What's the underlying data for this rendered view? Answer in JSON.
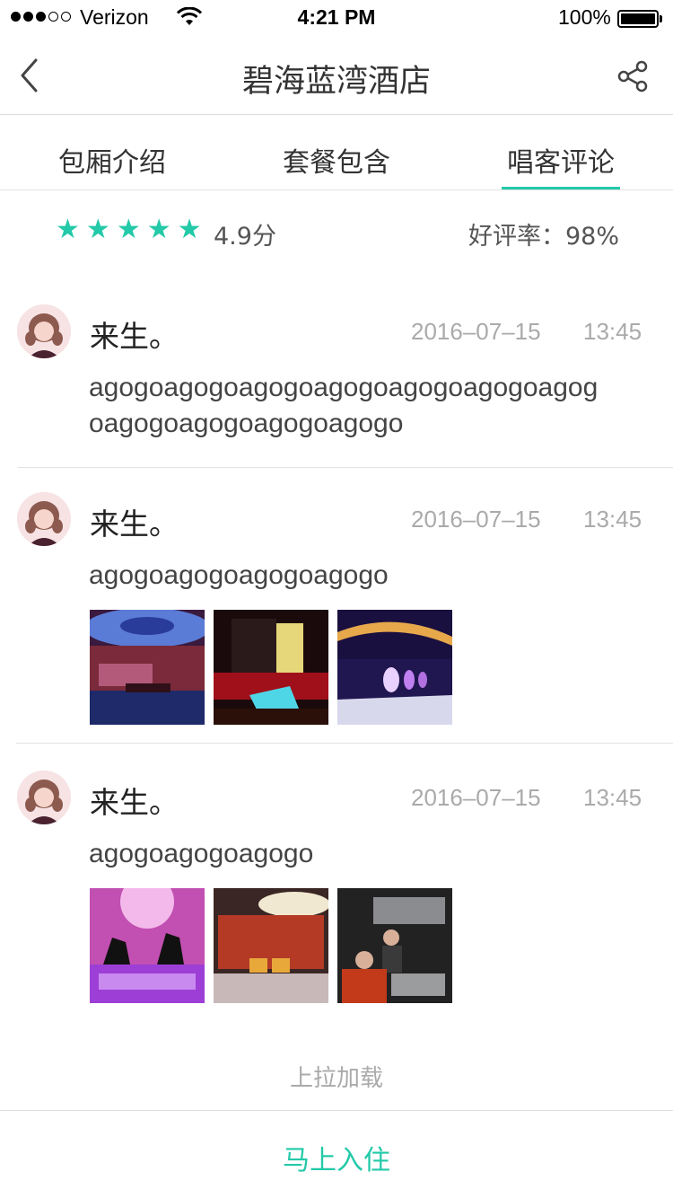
{
  "status_bar": {
    "carrier": "Verizon",
    "time": "4:21 PM",
    "battery": "100%"
  },
  "nav": {
    "title": "碧海蓝湾酒店",
    "back_icon": "chevron-left-icon",
    "share_icon": "share-icon"
  },
  "tabs": [
    {
      "label": "包厢介绍",
      "active": false
    },
    {
      "label": "套餐包含",
      "active": false
    },
    {
      "label": "唱客评论",
      "active": true
    }
  ],
  "rating": {
    "stars": 5,
    "score": "4.9分",
    "good_rate": "好评率：98%"
  },
  "reviews": [
    {
      "name": "来生。",
      "date": "2016–07–15",
      "time": "13:45",
      "text": "agogoagogoagogoagogoagogoagogoagogoagogoagogoagogoagogo",
      "photos": []
    },
    {
      "name": "来生。",
      "date": "2016–07–15",
      "time": "13:45",
      "text": "agogoagogoagogoagogo",
      "photos": [
        "ktv-room-photo",
        "ktv-lounge-photo",
        "ktv-bar-photo"
      ]
    },
    {
      "name": "来生。",
      "date": "2016–07–15",
      "time": "13:45",
      "text": "agogoagogoagogo",
      "photos": [
        "party-dance-photo",
        "hall-seating-photo",
        "guests-photo"
      ]
    }
  ],
  "load_more": "上拉加载",
  "bottom_button": "马上入住",
  "colors": {
    "accent": "#23c9a8",
    "muted_text": "#aaaaaa",
    "divider": "#e2e2e2"
  }
}
